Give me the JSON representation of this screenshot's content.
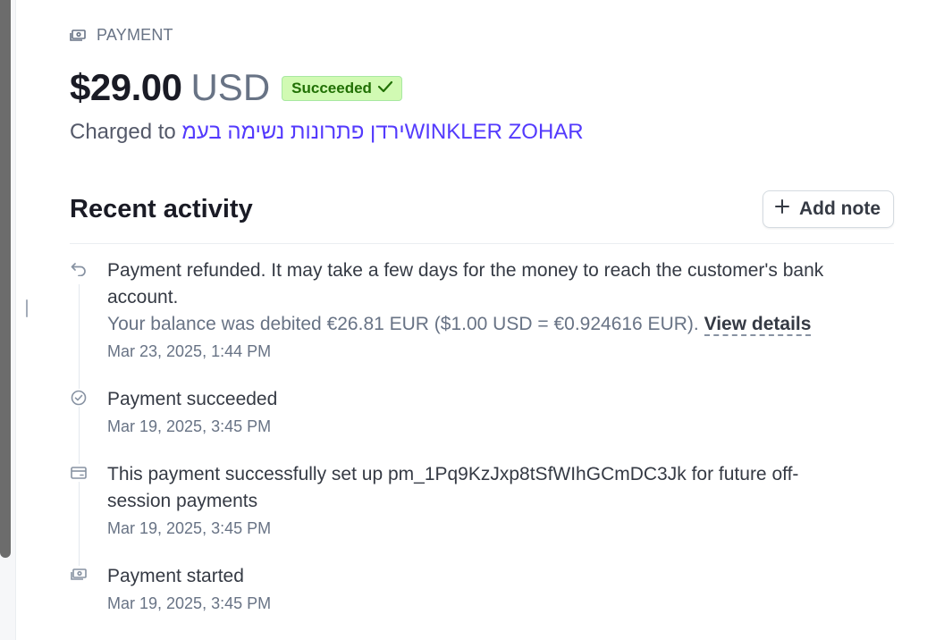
{
  "header": {
    "section_label": "PAYMENT",
    "amount": "$29.00",
    "currency": "USD",
    "status_badge": "Succeeded",
    "charged_prefix": "Charged to",
    "customer_name": "ירדן פתרונות נשימה בעמWINKLER ZOHAR"
  },
  "activity": {
    "title": "Recent activity",
    "add_note_label": "Add note",
    "events": [
      {
        "icon": "refund-icon",
        "text": "Payment refunded. It may take a few days for the money to reach the customer's bank account.",
        "sub_text": "Your balance was debited €26.81 EUR ($1.00 USD = €0.924616 EUR).",
        "link_label": "View details",
        "time": "Mar 23, 2025, 1:44 PM"
      },
      {
        "icon": "check-circle-icon",
        "text": "Payment succeeded",
        "time": "Mar 19, 2025, 3:45 PM"
      },
      {
        "icon": "card-icon",
        "text": "This payment successfully set up pm_1Pq9KzJxp8tSfWIhGCmDC3Jk for future off-session payments",
        "time": "Mar 19, 2025, 3:45 PM"
      },
      {
        "icon": "payment-icon",
        "text": "Payment started",
        "time": "Mar 19, 2025, 3:45 PM"
      }
    ]
  },
  "colors": {
    "accent_link": "#533afd",
    "success_bg": "#d1fab3",
    "success_text": "#217005",
    "muted_text": "#687385"
  }
}
